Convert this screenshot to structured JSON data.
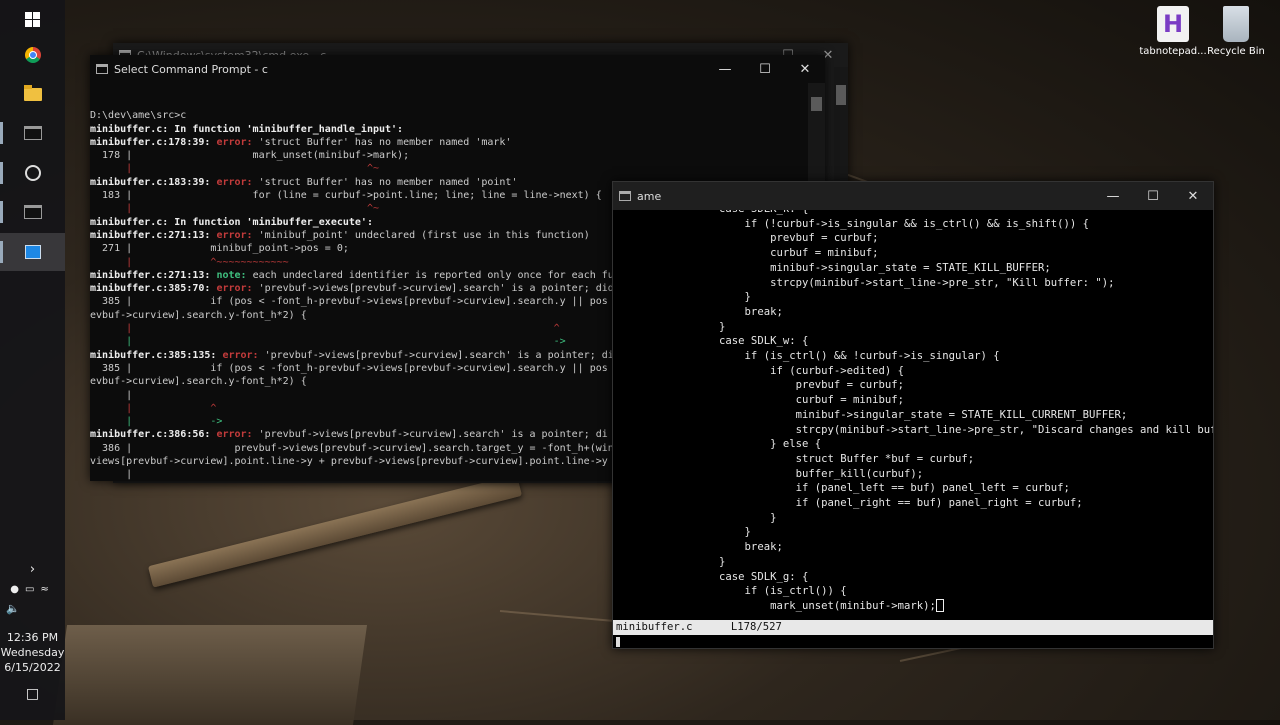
{
  "taskbar": {
    "clock_time": "12:36 PM",
    "clock_day": "Wednesday",
    "clock_date": "6/15/2022"
  },
  "desktop": {
    "icons": [
      {
        "label": "tabnotepad...",
        "icon": "tabnotepad-icon"
      },
      {
        "label": "Recycle Bin",
        "icon": "recycle-bin-icon"
      }
    ]
  },
  "cmd_back": {
    "title": "C:\\Windows\\system32\\cmd.exe - c"
  },
  "cmd": {
    "title": "Select Command Prompt - c",
    "lines": [
      "D:\\dev\\ame\\src>c",
      "minibuffer.c: In function 'minibuffer_handle_input':",
      "minibuffer.c:178:39: error: 'struct Buffer' has no member named 'mark'",
      "  178 |                    mark_unset(minibuf->mark);",
      "      |                                       ^~",
      "minibuffer.c:183:39: error: 'struct Buffer' has no member named 'point'",
      "  183 |                    for (line = curbuf->point.line; line; line = line->next) {",
      "      |                                       ^~",
      "minibuffer.c: In function 'minibuffer_execute':",
      "minibuffer.c:271:13: error: 'minibuf_point' undeclared (first use in this function)",
      "  271 |             minibuf_point->pos = 0;",
      "      |             ^~~~~~~~~~~~~",
      "minibuffer.c:271:13: note: each undeclared identifier is reported only once for each fu",
      "minibuffer.c:385:70: error: 'prevbuf->views[prevbuf->curview].search' is a pointer; did",
      "  385 |             if (pos < -font_h-prevbuf->views[prevbuf->curview].search.y || pos",
      "evbuf->curview].search.y-font_h*2) {",
      "      |                                                                      ^",
      "      |                                                                      ->",
      "",
      "minibuffer.c:385:135: error: 'prevbuf->views[prevbuf->curview].search' is a pointer; di",
      "  385 |             if (pos < -font_h-prevbuf->views[prevbuf->curview].search.y || pos",
      "evbuf->curview].search.y-font_h*2) {",
      "      |",
      "      |             ^",
      "      |             ->",
      "",
      "minibuffer.c:386:56: error: 'prevbuf->views[prevbuf->curview].search' is a pointer; di",
      "  386 |                 prevbuf->views[prevbuf->curview].search.target_y = -font_h+(win",
      "views[prevbuf->curview].point.line->y + prevbuf->views[prevbuf->curview].point.line->y",
      "      |"
    ]
  },
  "ame": {
    "title": "ame",
    "lines": [
      "                case SDLK_k: {",
      "                    if (!curbuf->is_singular && is_ctrl() && is_shift()) {",
      "                        prevbuf = curbuf;",
      "                        curbuf = minibuf;",
      "                        minibuf->singular_state = STATE_KILL_BUFFER;",
      "                        strcpy(minibuf->start_line->pre_str, \"Kill buffer: \");",
      "                    }",
      "                    break;",
      "                }",
      "",
      "                case SDLK_w: {",
      "                    if (is_ctrl() && !curbuf->is_singular) {",
      "                        if (curbuf->edited) {",
      "                            prevbuf = curbuf;",
      "                            curbuf = minibuf;",
      "                            minibuf->singular_state = STATE_KILL_CURRENT_BUFFER;",
      "                            strcpy(minibuf->start_line->pre_str, \"Discard changes and kill buf",
      "                        } else {",
      "                            struct Buffer *buf = curbuf;",
      "                            buffer_kill(curbuf);",
      "                            if (panel_left == buf) panel_left = curbuf;",
      "                            if (panel_right == buf) panel_right = curbuf;",
      "                        }",
      "                    }",
      "                    break;",
      "                }",
      "                case SDLK_g: {",
      "                    if (is_ctrl()) {",
      "                        mark_unset(minibuf->mark);"
    ],
    "modeline_file": "minibuffer.c",
    "modeline_pos": "L178/527"
  },
  "colors": {
    "error": "#c23b3b",
    "note": "#3fbf7f",
    "terminal_bg": "#0c0c0c",
    "taskbar_bg": "#141418"
  }
}
